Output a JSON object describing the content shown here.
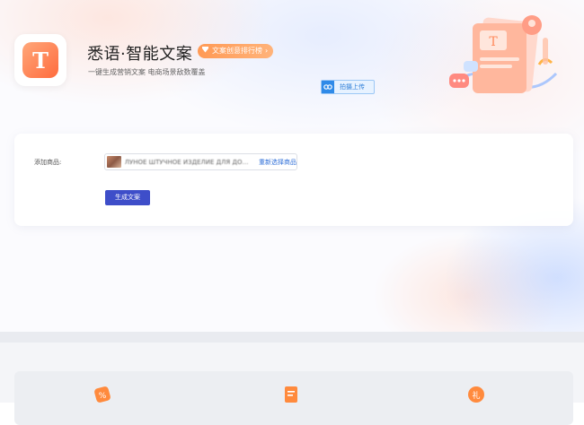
{
  "header": {
    "app_title": "悉语·智能文案",
    "rank_badge_label": "文案创意排行榜",
    "rank_badge_arrow": "›",
    "subtitle": "一键生成营销文案 电商场景敌数覆盖",
    "logo_letter": "T"
  },
  "toolbar": {
    "upload_label": "拍摄上传"
  },
  "illustration": {
    "doc_letter": "T"
  },
  "form": {
    "add_product_label": "添加商品:",
    "product_name": "ЛУНОЕ ШТУЧНОЕ ИЗДЕЛИЕ ДЛЯ ДОМА СКЕЕ...",
    "reselect_label": "重新选择商品",
    "generate_label": "生成文案"
  },
  "colors": {
    "accent_orange": "#ff7a45",
    "primary_blue": "#3e4ec9",
    "link_blue": "#2f6fd8"
  },
  "bottom_features": {
    "icons": [
      "percent-tag-icon",
      "document-icon",
      "orange-badge-icon"
    ],
    "badge_text": "礼"
  }
}
